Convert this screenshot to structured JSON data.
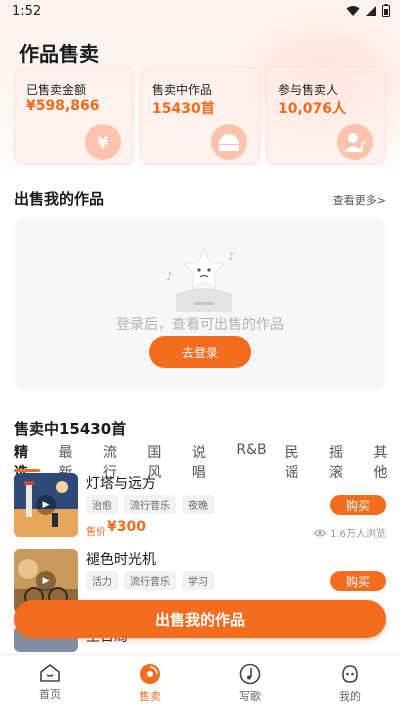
{
  "status_bar": {
    "time": "1:52"
  },
  "page_title": "作品售卖",
  "stats": [
    {
      "label": "已售卖金额",
      "value": "¥598,866",
      "icon": "yen-icon"
    },
    {
      "label": "售卖中作品",
      "value": "15430首",
      "icon": "record-player-icon"
    },
    {
      "label": "参与售卖人",
      "value": "10,076人",
      "icon": "person-music-icon"
    }
  ],
  "my_works": {
    "title": "出售我的作品",
    "more": "查看更多>",
    "empty_message": "登录后，查看可出售的作品",
    "login_button": "去登录"
  },
  "on_sale": {
    "title": "售卖中15430首",
    "tabs": [
      "精选",
      "最新",
      "流行",
      "国风",
      "说唱",
      "R&B",
      "民谣",
      "摇滚",
      "其他"
    ],
    "active_tab": "精选",
    "songs": [
      {
        "name": "灯塔与远方",
        "tags": [
          "治愈",
          "流行音乐",
          "夜晚"
        ],
        "price_label": "售价",
        "price": "¥300",
        "buy": "购买",
        "views": "1.6万人浏览"
      },
      {
        "name": "褪色时光机",
        "tags": [
          "活力",
          "流行音乐",
          "学习"
        ],
        "buy": "购买"
      },
      {
        "name": "生日局"
      }
    ]
  },
  "sell_button": "出售我的作品",
  "tabbar": [
    {
      "label": "首页",
      "icon": "home-icon"
    },
    {
      "label": "售卖",
      "icon": "sell-disc-icon",
      "active": true
    },
    {
      "label": "写歌",
      "icon": "write-song-icon"
    },
    {
      "label": "我的",
      "icon": "profile-icon"
    }
  ],
  "colors": {
    "accent": "#f46d1f",
    "accent_text": "#f26a1b"
  }
}
